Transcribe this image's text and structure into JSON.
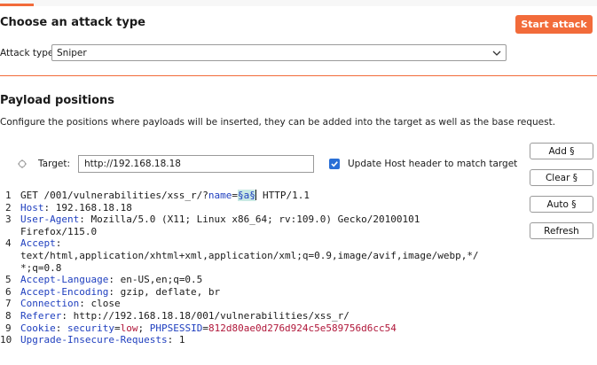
{
  "attack": {
    "title": "Choose an attack type",
    "start_label": "Start attack",
    "type_label": "Attack type:",
    "type_value": "Sniper"
  },
  "positions": {
    "title": "Payload positions",
    "description": "Configure the positions where payloads will be inserted, they can be added into the target as well as the base request.",
    "target_label": "Target:",
    "target_value": "http://192.168.18.18",
    "update_host_label": "Update Host header to match target",
    "update_host_checked": true,
    "buttons": {
      "add": "Add §",
      "clear": "Clear §",
      "auto": "Auto §",
      "refresh": "Refresh"
    }
  },
  "request": {
    "line1": {
      "num": "1",
      "before": "GET /001/vulnerabilities/xss_r/?",
      "param": "name",
      "eq": "=",
      "marker": "§a§",
      "after": " HTTP/1.1"
    },
    "line2": {
      "num": "2",
      "key": "Host",
      "value": ": 192.168.18.18"
    },
    "line3": {
      "num": "3",
      "key": "User-Agent",
      "value": ": Mozilla/5.0 (X11; Linux x86_64; rv:109.0) Gecko/20100101"
    },
    "line3b": "Firefox/115.0",
    "line4": {
      "num": "4",
      "key": "Accept",
      "value": ":"
    },
    "line4b": "text/html,application/xhtml+xml,application/xml;q=0.9,image/avif,image/webp,*/",
    "line4c": "*;q=0.8",
    "line5": {
      "num": "5",
      "key": "Accept-Language",
      "value": ": en-US,en;q=0.5"
    },
    "line6": {
      "num": "6",
      "key": "Accept-Encoding",
      "value": ": gzip, deflate, br"
    },
    "line7": {
      "num": "7",
      "key": "Connection",
      "value": ": close"
    },
    "line8": {
      "num": "8",
      "key": "Referer",
      "value": ": http://192.168.18.18/001/vulnerabilities/xss_r/"
    },
    "line9": {
      "num": "9",
      "key": "Cookie",
      "value": ": ",
      "ck1_name": "security",
      "ck1_eq": "=",
      "ck1_val": "low",
      "sep": "; ",
      "ck2_name": "PHPSESSID",
      "ck2_eq": "=",
      "ck2_val": "812d80ae0d276d924c5e589756d6cc54"
    },
    "line10": {
      "num": "10",
      "key": "Upgrade-Insecure-Requests",
      "value": ": 1"
    }
  }
}
